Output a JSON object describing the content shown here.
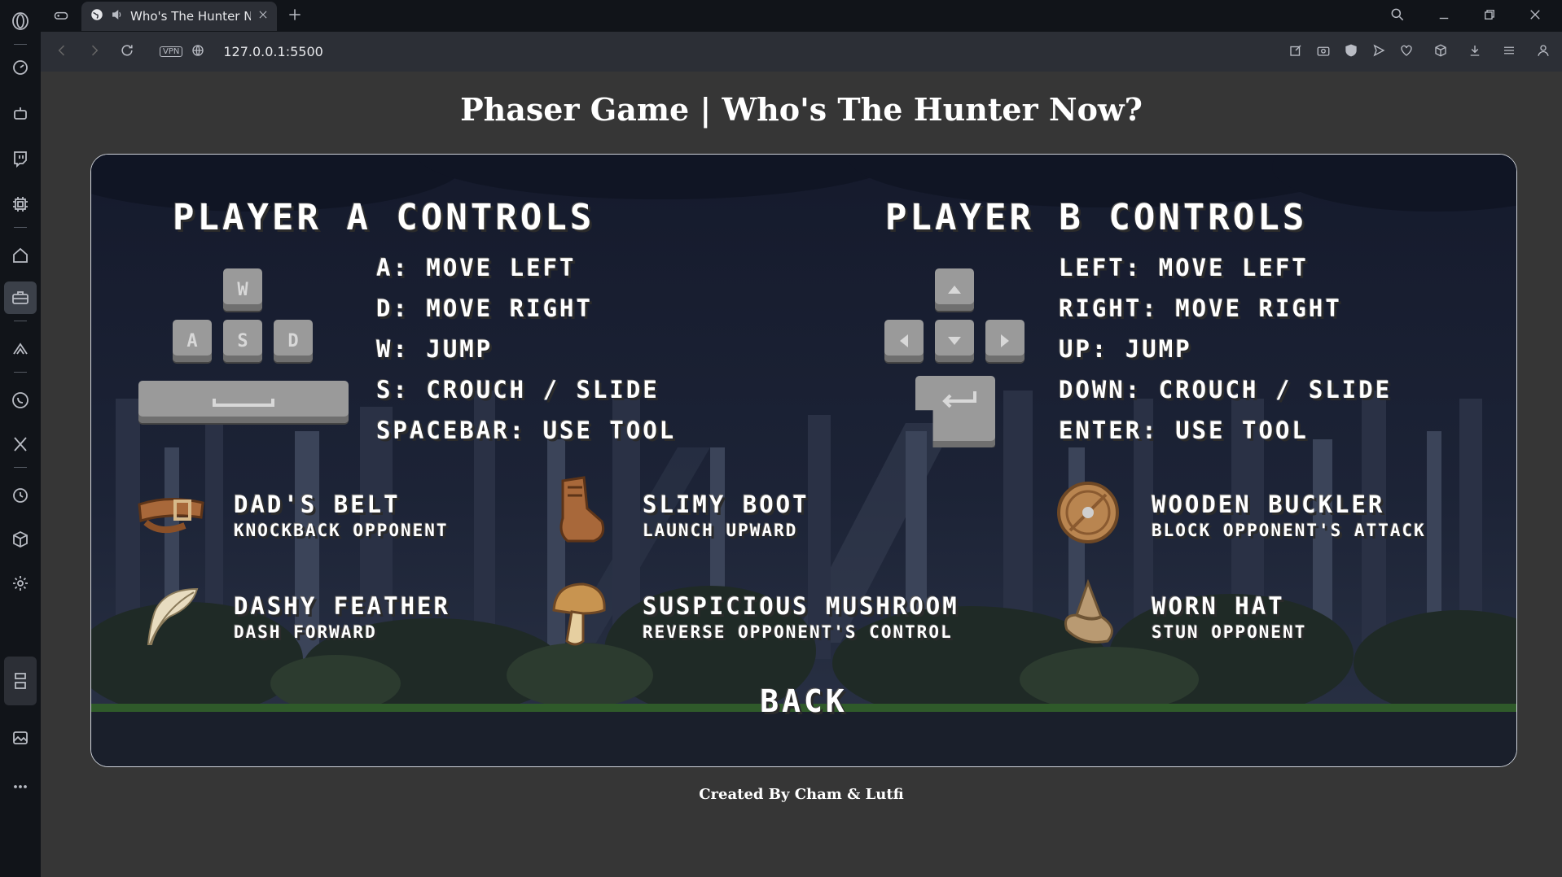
{
  "browser": {
    "tab_title": "Who's The Hunter Now",
    "url": "127.0.0.1:5500",
    "vpn_badge": "VPN"
  },
  "page": {
    "title": "Phaser Game | Who's The Hunter Now?",
    "footer": "Created By Cham & Lutfi"
  },
  "game": {
    "player_a": {
      "heading": "Player A Controls",
      "lines": [
        "A: Move Left",
        "D: Move Right",
        "W: Jump",
        "S: Crouch / Slide",
        "Spacebar: Use Tool"
      ],
      "keys": [
        "W",
        "A",
        "S",
        "D"
      ]
    },
    "player_b": {
      "heading": "Player B Controls",
      "lines": [
        "Left: Move Left",
        "Right: Move Right",
        "Up: Jump",
        "Down: Crouch / Slide",
        "Enter: Use Tool"
      ]
    },
    "items": [
      {
        "name": "Dad's Belt",
        "desc": "Knockback Opponent",
        "icon": "belt-icon"
      },
      {
        "name": "Slimy Boot",
        "desc": "Launch Upward",
        "icon": "boot-icon"
      },
      {
        "name": "Wooden Buckler",
        "desc": "Block Opponent's Attack",
        "icon": "shield-icon"
      },
      {
        "name": "Dashy Feather",
        "desc": "Dash Forward",
        "icon": "feather-icon"
      },
      {
        "name": "Suspicious Mushroom",
        "desc": "Reverse Opponent's Control",
        "icon": "mushroom-icon"
      },
      {
        "name": "Worn Hat",
        "desc": "Stun Opponent",
        "icon": "hat-icon"
      }
    ],
    "back_label": "Back"
  }
}
